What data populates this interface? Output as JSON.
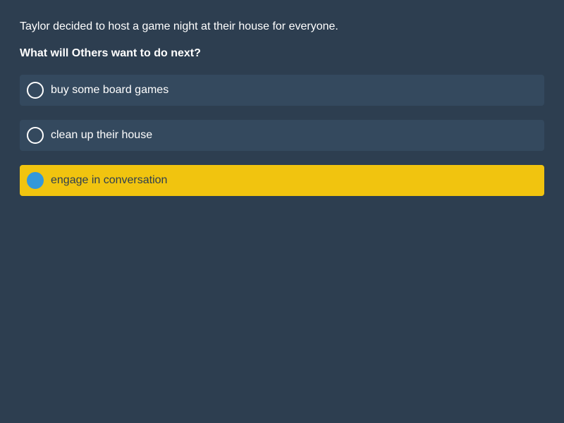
{
  "context": "Taylor decided to host a game night at their house for everyone.",
  "question": "What will Others want to do next?",
  "options": [
    {
      "label": "buy some board games",
      "selected": false
    },
    {
      "label": "clean up their house",
      "selected": false
    },
    {
      "label": "engage in conversation",
      "selected": true
    }
  ],
  "colors": {
    "background": "#2d3e50",
    "option_background": "#34495e",
    "selected_background": "#f1c40f",
    "selected_radio": "#3498db"
  }
}
